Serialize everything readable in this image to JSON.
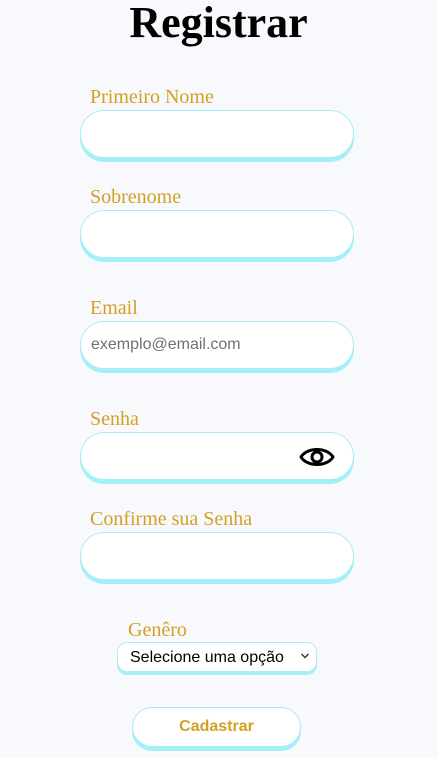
{
  "form": {
    "title": "Registrar",
    "first_name": {
      "label": "Primeiro Nome",
      "value": "",
      "placeholder": ""
    },
    "last_name": {
      "label": "Sobrenome",
      "value": "",
      "placeholder": ""
    },
    "email": {
      "label": "Email",
      "value": "",
      "placeholder": "exemplo@email.com"
    },
    "password": {
      "label": "Senha",
      "value": "",
      "placeholder": "",
      "toggle_icon": "eye-icon"
    },
    "confirm_password": {
      "label": "Confirme sua Senha",
      "value": "",
      "placeholder": ""
    },
    "gender": {
      "label": "Genêro",
      "selected": "Selecione uma opção"
    },
    "submit_label": "Cadastrar"
  },
  "colors": {
    "label": "#d4a024",
    "field_border": "#a8eef6",
    "field_shadow": "#a3f0f8",
    "background": "#f8f9fc",
    "title": "#000000"
  }
}
